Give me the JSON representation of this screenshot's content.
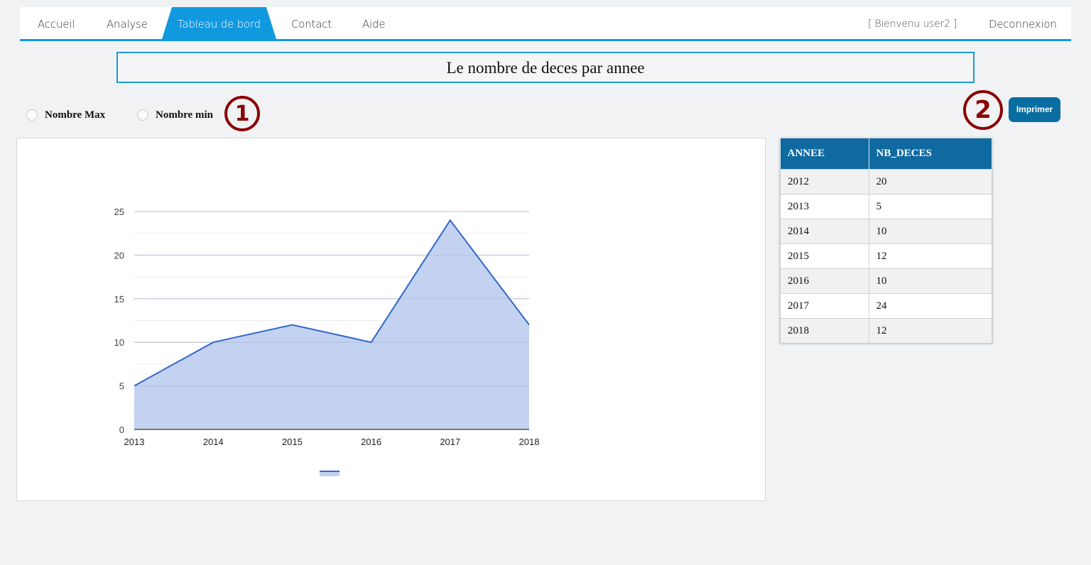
{
  "nav": {
    "items": [
      "Accueil",
      "Analyse",
      "Tableau de bord",
      "Contact",
      "Aide"
    ],
    "active": "Tableau de bord",
    "welcome": "[ Bienvenu user2 ]",
    "logout": "Deconnexion"
  },
  "page_title": "Le nombre de deces par annee",
  "filters": {
    "max_label": "Nombre Max",
    "min_label": "Nombre min"
  },
  "markers": {
    "one": "1",
    "two": "2"
  },
  "print_label": "Imprimer",
  "chart_data": {
    "type": "area",
    "x": [
      "2013",
      "2014",
      "2015",
      "2016",
      "2017",
      "2018"
    ],
    "series": [
      {
        "values": [
          5,
          10,
          12,
          10,
          24,
          12
        ]
      }
    ],
    "ylim": [
      0,
      25
    ],
    "yticks": [
      0,
      5,
      10,
      15,
      20,
      25
    ],
    "grid": true,
    "legend": "bottom",
    "line_color": "#3366cc",
    "fill_color": "#c0d0ef"
  },
  "table": {
    "headers": [
      "ANNEE",
      "NB_DECES"
    ],
    "rows": [
      [
        "2012",
        "20"
      ],
      [
        "2013",
        "5"
      ],
      [
        "2014",
        "10"
      ],
      [
        "2015",
        "12"
      ],
      [
        "2016",
        "10"
      ],
      [
        "2017",
        "24"
      ],
      [
        "2018",
        "12"
      ]
    ]
  }
}
